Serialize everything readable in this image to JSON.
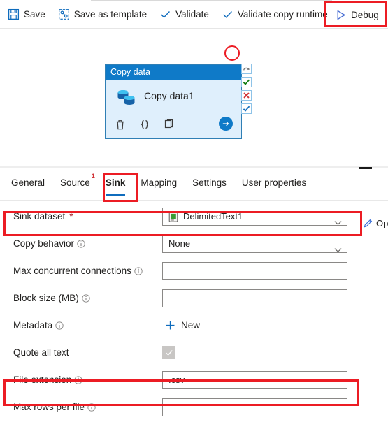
{
  "toolbar": {
    "save_label": "Save",
    "save_as_template_label": "Save as template",
    "validate_label": "Validate",
    "validate_copy_runtime_label": "Validate copy runtime",
    "debug_label": "Debug"
  },
  "canvas": {
    "activity": {
      "header": "Copy data",
      "name": "Copy data1",
      "icon": "copy-data-icon",
      "actions": [
        {
          "name": "delete-activity",
          "icon": "trash-icon"
        },
        {
          "name": "view-code",
          "icon": "code-braces-icon"
        },
        {
          "name": "clone-activity",
          "icon": "copy-icon"
        },
        {
          "name": "run-activity",
          "icon": "arrow-right-icon"
        }
      ],
      "status_outputs": [
        {
          "name": "skipped",
          "icon": "skip-arrow-icon",
          "color": "#767676"
        },
        {
          "name": "success",
          "icon": "check-icon",
          "color": "#107c10"
        },
        {
          "name": "failure",
          "icon": "x-icon",
          "color": "#d13438"
        },
        {
          "name": "completion",
          "icon": "check-icon",
          "color": "#0f6cbd"
        }
      ]
    },
    "annotation_circle": "red-circle-annotation"
  },
  "tabs": [
    {
      "label": "General",
      "active": false,
      "badge": ""
    },
    {
      "label": "Source",
      "active": false,
      "badge": "1"
    },
    {
      "label": "Sink",
      "active": true,
      "badge": ""
    },
    {
      "label": "Mapping",
      "active": false,
      "badge": ""
    },
    {
      "label": "Settings",
      "active": false,
      "badge": ""
    },
    {
      "label": "User properties",
      "active": false,
      "badge": ""
    }
  ],
  "form": {
    "sink_dataset": {
      "label": "Sink dataset",
      "required": "*",
      "value": "DelimitedText1",
      "icon": "dataset-file-icon",
      "open_label": "Op"
    },
    "copy_behavior": {
      "label": "Copy behavior",
      "value": "None"
    },
    "max_concurrent_connections": {
      "label": "Max concurrent connections",
      "value": "",
      "placeholder": ""
    },
    "block_size": {
      "label": "Block size (MB)",
      "value": "",
      "placeholder": ""
    },
    "metadata": {
      "label": "Metadata",
      "new_label": "New"
    },
    "quote_all_text": {
      "label": "Quote all text",
      "checked": true,
      "disabled": true
    },
    "file_extension": {
      "label": "File extension",
      "value": ".csv",
      "placeholder": ""
    },
    "max_rows_per_file": {
      "label": "Max rows per file",
      "value": "",
      "placeholder": ""
    }
  },
  "colors": {
    "accent": "#0f6cbd",
    "annotation_red": "#ec1c24",
    "card_header": "#0f7ac8",
    "card_body": "#dfeffc",
    "required_red": "#a4262c"
  }
}
